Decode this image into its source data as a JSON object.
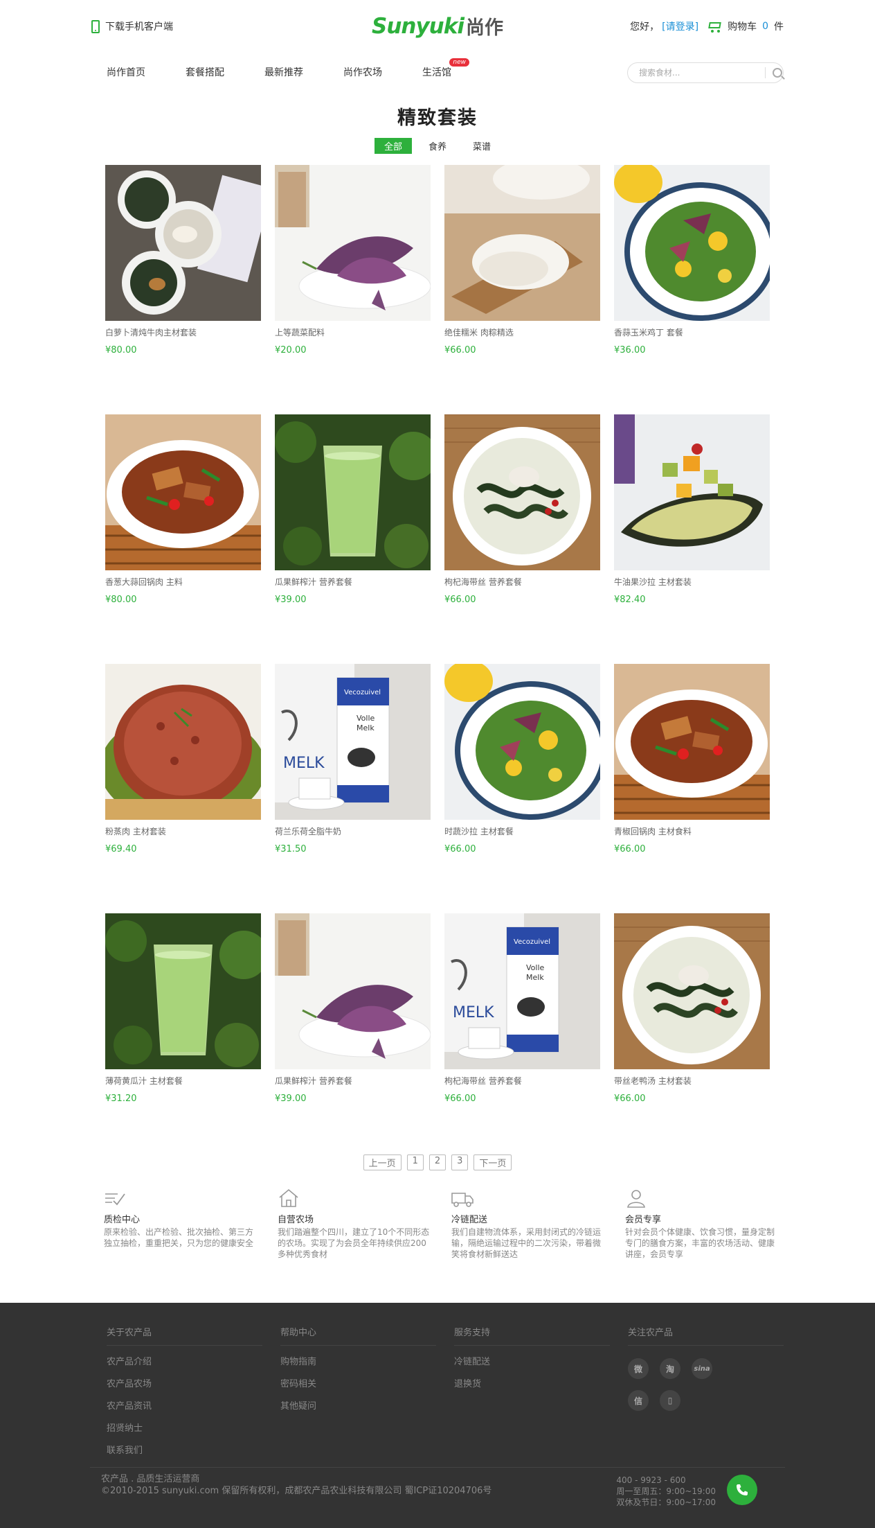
{
  "header": {
    "app_download": "下载手机客户端",
    "logo_en": "Sunyuki",
    "logo_cn": "尚作",
    "greeting": "您好，",
    "login": "[请登录]",
    "cart_label": "购物车",
    "cart_count": "0",
    "cart_unit": "件"
  },
  "nav": {
    "items": [
      "尚作首页",
      "套餐搭配",
      "最新推荐",
      "尚作农场",
      "生活馆"
    ],
    "new_badge": "new",
    "search_placeholder": "搜索食材..."
  },
  "section": {
    "title": "精致套装",
    "filters": [
      "全部",
      "食养",
      "菜谱"
    ],
    "active_filter": "全部"
  },
  "products": [
    {
      "name": "白萝卜清炖牛肉主材套装",
      "price": "¥80.00",
      "image": "soup-bowls"
    },
    {
      "name": "上等蔬菜配料",
      "price": "¥20.00",
      "image": "purple-greens"
    },
    {
      "name": "绝佳糯米 肉粽精选",
      "price": "¥66.00",
      "image": "rice-spoon"
    },
    {
      "name": "香蒜玉米鸡丁 套餐",
      "price": "¥36.00",
      "image": "corn-salad"
    },
    {
      "name": "香葱大蒜回锅肉 主料",
      "price": "¥80.00",
      "image": "pork-stirfry"
    },
    {
      "name": "瓜果鲜榨汁 营养套餐",
      "price": "¥39.00",
      "image": "green-juice"
    },
    {
      "name": "枸杞海带丝 营养套餐",
      "price": "¥66.00",
      "image": "kelp-soup"
    },
    {
      "name": "牛油果沙拉 主材套装",
      "price": "¥82.40",
      "image": "avocado-salad"
    },
    {
      "name": "粉蒸肉 主材套装",
      "price": "¥69.40",
      "image": "steamed-pork"
    },
    {
      "name": "荷兰乐荷全脂牛奶",
      "price": "¥31.50",
      "image": "milk-carton"
    },
    {
      "name": "时蔬沙拉 主材套餐",
      "price": "¥66.00",
      "image": "corn-salad"
    },
    {
      "name": "青椒回锅肉 主材食料",
      "price": "¥66.00",
      "image": "pork-stirfry"
    },
    {
      "name": "薄荷黄瓜汁 主材套餐",
      "price": "¥31.20",
      "image": "green-juice"
    },
    {
      "name": "瓜果鲜榨汁 营养套餐",
      "price": "¥39.00",
      "image": "purple-greens"
    },
    {
      "name": "枸杞海带丝 营养套餐",
      "price": "¥66.00",
      "image": "milk-carton"
    },
    {
      "name": "带丝老鸭汤 主材套装",
      "price": "¥66.00",
      "image": "kelp-soup"
    }
  ],
  "pagination": {
    "prev": "上一页",
    "pages": [
      "1",
      "2",
      "3"
    ],
    "next": "下一页"
  },
  "features": [
    {
      "title": "质检中心",
      "desc": "原来检验、出产检验、批次抽检、第三方独立抽检，重重把关，只为您的健康安全",
      "icon": "quality-check-icon"
    },
    {
      "title": "自营农场",
      "desc": "我们踏遍整个四川，建立了10个不同形态的农场。实现了为会员全年持续供应200多种优秀食材",
      "icon": "farm-house-icon"
    },
    {
      "title": "冷链配送",
      "desc": "我们自建物流体系，采用封闭式的冷链运输，隔绝运输过程中的二次污染，带着微笑将食材新鲜送达",
      "icon": "delivery-truck-icon"
    },
    {
      "title": "会员专享",
      "desc": "针对会员个体健康、饮食习惯，量身定制专门的膳食方案，丰富的农场活动、健康讲座，会员专享",
      "icon": "member-icon"
    }
  ],
  "footer": {
    "columns": [
      {
        "title": "关于农产品",
        "links": [
          "农产品介绍",
          "农产品农场",
          "农产品资讯",
          "招贤纳士",
          "联系我们"
        ]
      },
      {
        "title": "帮助中心",
        "links": [
          "购物指南",
          "密码相关",
          "其他疑问"
        ]
      },
      {
        "title": "服务支持",
        "links": [
          "冷链配送",
          "退换货"
        ]
      },
      {
        "title": "关注农产品",
        "links": []
      }
    ],
    "social": [
      "weibo-icon",
      "taobao-icon",
      "sina-icon",
      "wechat-icon",
      "mobile-icon"
    ],
    "social_labels": [
      "微",
      "淘",
      "sina",
      "信",
      "▯"
    ],
    "copy1": "农产品 . 品质生活运营商",
    "copy2": "©2010-2015 sunyuki.com 保留所有权利，成都农产品农业科技有限公司 蜀ICP证10204706号",
    "phone": "400 - 9923 - 600",
    "hours1": "周一至周五：9:00~19:00",
    "hours2": "双休及节日：9:00~17:00"
  },
  "colors": {
    "brand_green": "#2db03c",
    "link_blue": "#1a8fd6",
    "badge_red": "#e8303b",
    "footer_bg": "#333333"
  }
}
